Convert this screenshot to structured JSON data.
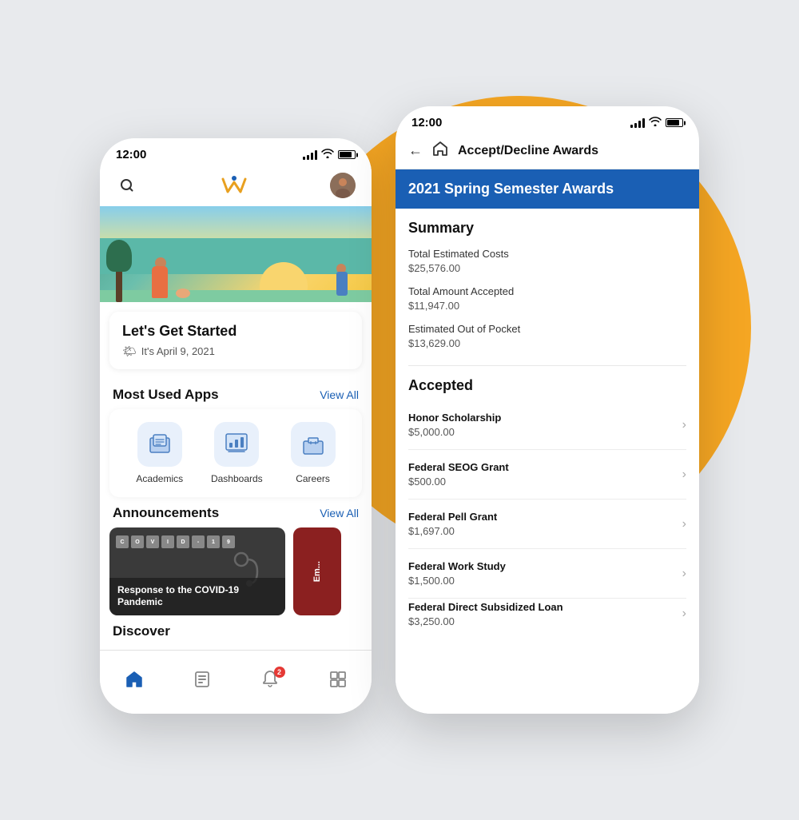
{
  "background": {
    "circle_color": "#F5A623"
  },
  "left_phone": {
    "status_bar": {
      "time": "12:00"
    },
    "nav": {
      "logo": "W",
      "search_aria": "Search"
    },
    "hero": {
      "aria": "Scenic banner image"
    },
    "get_started": {
      "title": "Let's Get Started",
      "date_label": "It's April 9, 2021",
      "sun_emoji": "🌤"
    },
    "most_used_apps": {
      "section_title": "Most Used Apps",
      "view_all": "View All",
      "apps": [
        {
          "label": "Academics",
          "icon": "academics-icon"
        },
        {
          "label": "Dashboards",
          "icon": "dashboards-icon"
        },
        {
          "label": "Careers",
          "icon": "careers-icon"
        }
      ]
    },
    "announcements": {
      "section_title": "Announcements",
      "view_all": "View All",
      "items": [
        {
          "title": "Response to the COVID-19 Pandemic",
          "type": "covid"
        },
        {
          "title": "Em...",
          "type": "emergency"
        }
      ]
    },
    "discover": {
      "section_title": "Discover"
    },
    "tab_bar": {
      "tabs": [
        {
          "label": "Home",
          "icon": "home-tab-icon",
          "active": true
        },
        {
          "label": "Files",
          "icon": "files-tab-icon",
          "active": false
        },
        {
          "label": "Notifications",
          "icon": "bell-tab-icon",
          "active": false,
          "badge": "2"
        },
        {
          "label": "Grid",
          "icon": "grid-tab-icon",
          "active": false
        }
      ]
    }
  },
  "right_phone": {
    "status_bar": {
      "time": "12:00"
    },
    "nav": {
      "title": "Accept/Decline Awards",
      "back_aria": "Back",
      "home_aria": "Home"
    },
    "awards_header": {
      "title": "2021 Spring Semester Awards"
    },
    "summary": {
      "section_title": "Summary",
      "items": [
        {
          "label": "Total Estimated Costs",
          "value": "$25,576.00"
        },
        {
          "label": "Total Amount Accepted",
          "value": "$11,947.00"
        },
        {
          "label": "Estimated Out of Pocket",
          "value": "$13,629.00"
        }
      ]
    },
    "accepted": {
      "section_title": "Accepted",
      "items": [
        {
          "name": "Honor Scholarship",
          "amount": "$5,000.00"
        },
        {
          "name": "Federal SEOG Grant",
          "amount": "$500.00"
        },
        {
          "name": "Federal Pell Grant",
          "amount": "$1,697.00"
        },
        {
          "name": "Federal Work Study",
          "amount": "$1,500.00"
        },
        {
          "name": "Federal Direct Subsidized Loan",
          "amount": "$3,250.00"
        }
      ]
    }
  }
}
